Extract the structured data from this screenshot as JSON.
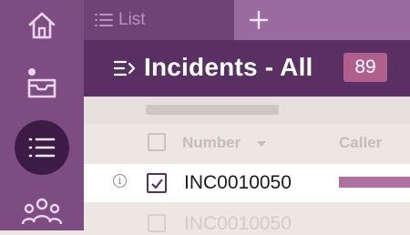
{
  "tab": {
    "label": "List",
    "new_tab_icon": "plus-icon"
  },
  "header": {
    "title": "Incidents - All",
    "count": "89"
  },
  "columns": [
    "Number",
    "Caller"
  ],
  "rows": [
    {
      "number": "INC0010050",
      "selected": true
    },
    {
      "number": "INC0010050",
      "selected": false
    }
  ],
  "rail": {
    "items": [
      "home-icon",
      "inbox-icon",
      "list-icon",
      "people-icon"
    ],
    "active": "list-icon"
  },
  "colors": {
    "rail": "#7c4c82",
    "header": "#5a2f63",
    "badge": "#b1608e",
    "accent": "#b0709f"
  }
}
